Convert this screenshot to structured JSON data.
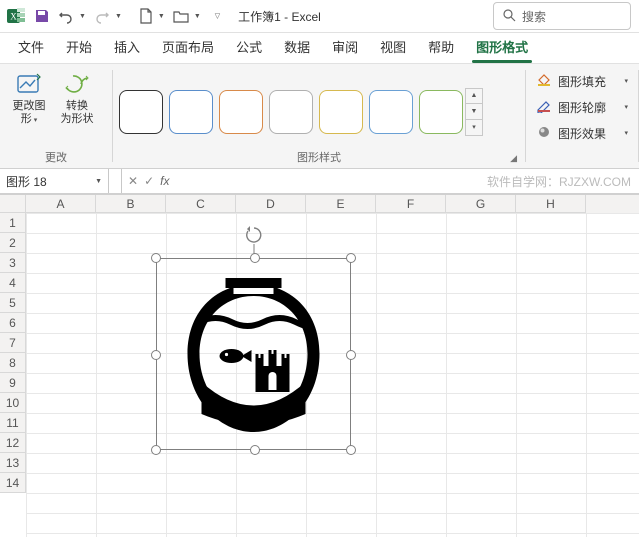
{
  "titlebar": {
    "title": "工作簿1 - Excel",
    "search_label": "搜索"
  },
  "tabs": {
    "file": "文件",
    "home": "开始",
    "insert": "插入",
    "pagelayout": "页面布局",
    "formulas": "公式",
    "data": "数据",
    "review": "审阅",
    "view": "视图",
    "help": "帮助",
    "shapeformat": "图形格式"
  },
  "ribbon": {
    "change_group": "更改",
    "change_graphic": "更改图\n形",
    "convert_to_shape": "转换\n为形状",
    "style_group": "图形样式",
    "fill": "图形填充",
    "outline": "图形轮廓",
    "effects": "图形效果"
  },
  "namebox": {
    "value": "图形 18"
  },
  "watermark": "软件自学网：RJZXW.COM",
  "grid": {
    "cols": [
      "A",
      "B",
      "C",
      "D",
      "E",
      "F",
      "G",
      "H"
    ],
    "rows": [
      "1",
      "2",
      "3",
      "4",
      "5",
      "6",
      "7",
      "8",
      "9",
      "10",
      "11",
      "12",
      "13",
      "14"
    ]
  }
}
